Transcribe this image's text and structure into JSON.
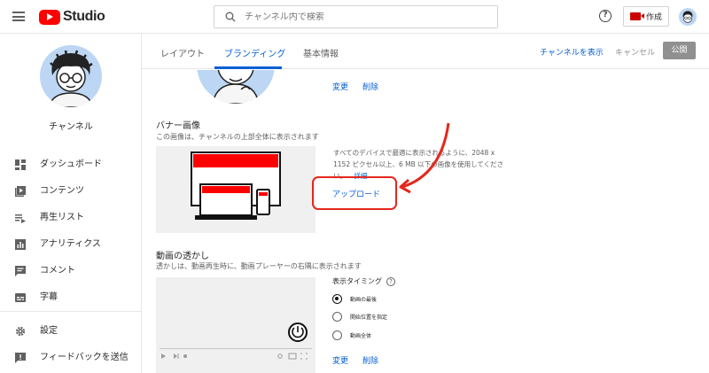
{
  "topbar": {
    "logo_text": "Studio",
    "search_placeholder": "チャンネル内で検索",
    "create_label": "作成",
    "help_glyph": "?"
  },
  "sidebar": {
    "channel_name": "チャンネル",
    "items": [
      {
        "label": "ダッシュボード",
        "icon": "dashboard-icon"
      },
      {
        "label": "コンテンツ",
        "icon": "content-icon"
      },
      {
        "label": "再生リスト",
        "icon": "playlist-icon"
      },
      {
        "label": "アナリティクス",
        "icon": "analytics-icon"
      },
      {
        "label": "コメント",
        "icon": "comment-icon"
      },
      {
        "label": "字幕",
        "icon": "subtitles-icon"
      },
      {
        "label": "設定",
        "icon": "settings-icon"
      },
      {
        "label": "フィードバックを送信",
        "icon": "feedback-icon"
      }
    ]
  },
  "tabs": [
    {
      "label": "レイアウト",
      "active": false
    },
    {
      "label": "ブランディング",
      "active": true
    },
    {
      "label": "基本情報",
      "active": false
    }
  ],
  "header_actions": {
    "view_channel": "チャンネルを表示",
    "cancel": "キャンセル",
    "publish": "公開"
  },
  "profile": {
    "change": "変更",
    "delete": "削除"
  },
  "banner": {
    "title": "バナー画像",
    "description": "この画像は、チャンネルの上部全体に表示されます",
    "info_line1": "すべてのデバイスで最適に表示されるように、2048 x",
    "info_line2": "1152 ピクセル以上、6 MB 以下の画像を使用してくださ",
    "info_line3": "い。",
    "details_link": "詳細",
    "upload": "アップロード"
  },
  "watermark": {
    "title": "動画の透かし",
    "description": "透かしは、動画再生時に、動画プレーヤーの右隅に表示されます",
    "timing_label": "表示タイミング",
    "options": [
      {
        "label": "動画の最後",
        "selected": true
      },
      {
        "label": "開始位置を指定",
        "selected": false
      },
      {
        "label": "動画全体",
        "selected": false
      }
    ],
    "change": "変更",
    "delete": "削除"
  },
  "colors": {
    "accent": "#065fd4",
    "brand_red": "#ff0000",
    "annotation_red": "#e4281d"
  }
}
